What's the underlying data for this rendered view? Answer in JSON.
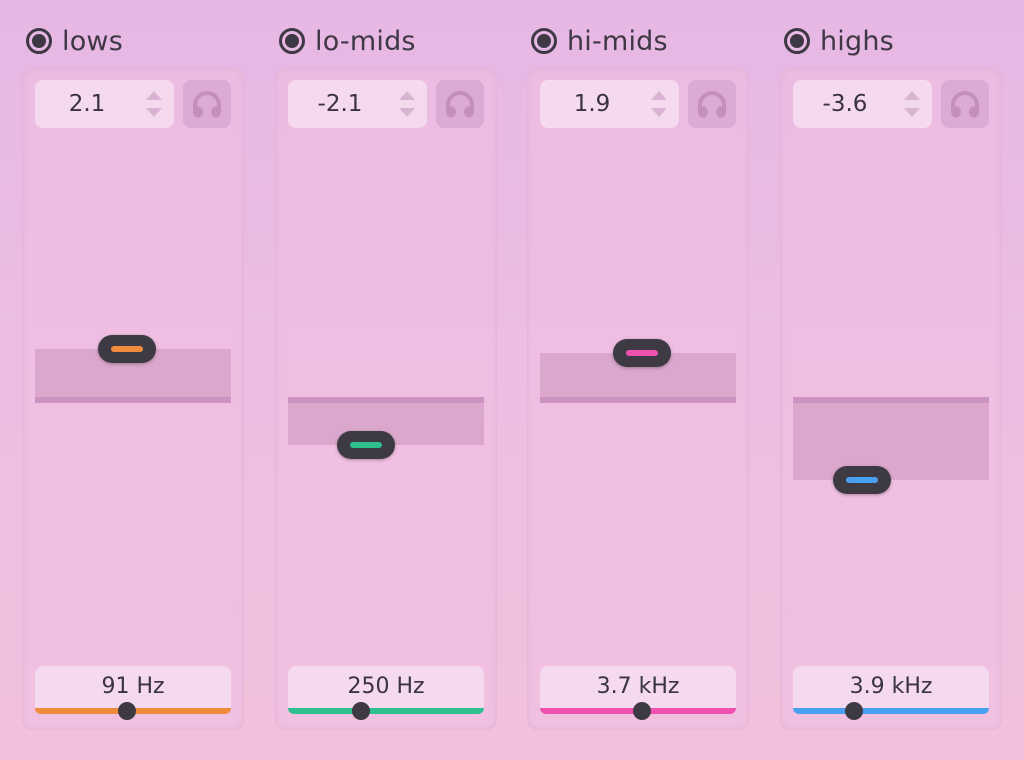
{
  "gain_range_db": [
    -11.5,
    11.5
  ],
  "bands": [
    {
      "name": "lows",
      "enabled": true,
      "gain": "2.1",
      "gain_db": 2.1,
      "freq_label": "91 Hz",
      "freq_position": 0.47,
      "color": "#f08a3c",
      "solo_icon": "headphones-icon"
    },
    {
      "name": "lo-mids",
      "enabled": true,
      "gain": "-2.1",
      "gain_db": -2.1,
      "freq_label": "250 Hz",
      "freq_position": 0.37,
      "color": "#2fbf8f",
      "solo_icon": "headphones-icon"
    },
    {
      "name": "hi-mids",
      "enabled": true,
      "gain": "1.9",
      "gain_db": 1.9,
      "freq_label": "3.7 kHz",
      "freq_position": 0.52,
      "color": "#f050b0",
      "solo_icon": "headphones-icon"
    },
    {
      "name": "highs",
      "enabled": true,
      "gain": "-3.6",
      "gain_db": -3.6,
      "freq_label": "3.9 kHz",
      "freq_position": 0.31,
      "color": "#4aa0f0",
      "solo_icon": "headphones-icon"
    }
  ]
}
